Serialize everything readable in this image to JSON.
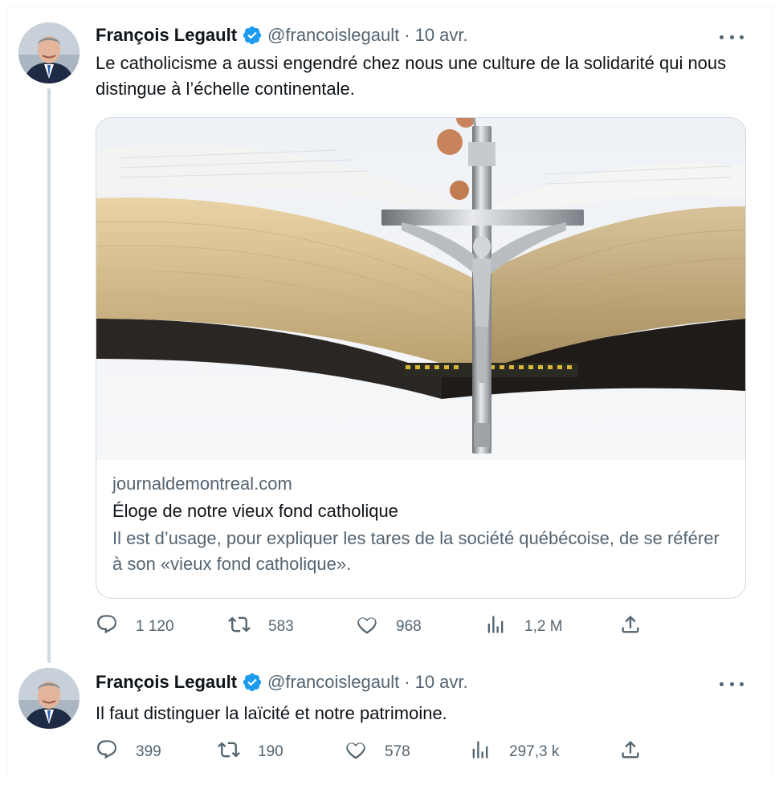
{
  "tweets": [
    {
      "author": "François Legault",
      "handle": "@francoislegault",
      "separator": "·",
      "date": "10 avr.",
      "text": "Le catholicisme a aussi engendré chez nous une culture de la solidarité qui nous distingue à l’échelle continentale.",
      "card": {
        "domain": "journaldemontreal.com",
        "title": "Éloge de notre vieux fond catholique",
        "description": "Il est d’usage, pour expliquer les tares de la société québécoise, de se référer à son «vieux fond catholique»."
      },
      "replies": "1 120",
      "retweets": "583",
      "likes": "968",
      "views": "1,2 M"
    },
    {
      "author": "François Legault",
      "handle": "@francoislegault",
      "separator": "·",
      "date": "10 avr.",
      "text": "Il faut distinguer la laïcité et notre patrimoine.",
      "replies": "399",
      "retweets": "190",
      "likes": "578",
      "views": "297,3 k"
    }
  ],
  "icons": {
    "verified": "verified-badge-icon",
    "more": "more-horizontal-icon",
    "reply": "reply-icon",
    "retweet": "retweet-icon",
    "like": "heart-icon",
    "views": "views-chart-icon",
    "share": "share-icon"
  },
  "colors": {
    "verified": "#1d9bf0",
    "text": "#0f1419",
    "secondary": "#536471",
    "border": "#cfd9de"
  }
}
